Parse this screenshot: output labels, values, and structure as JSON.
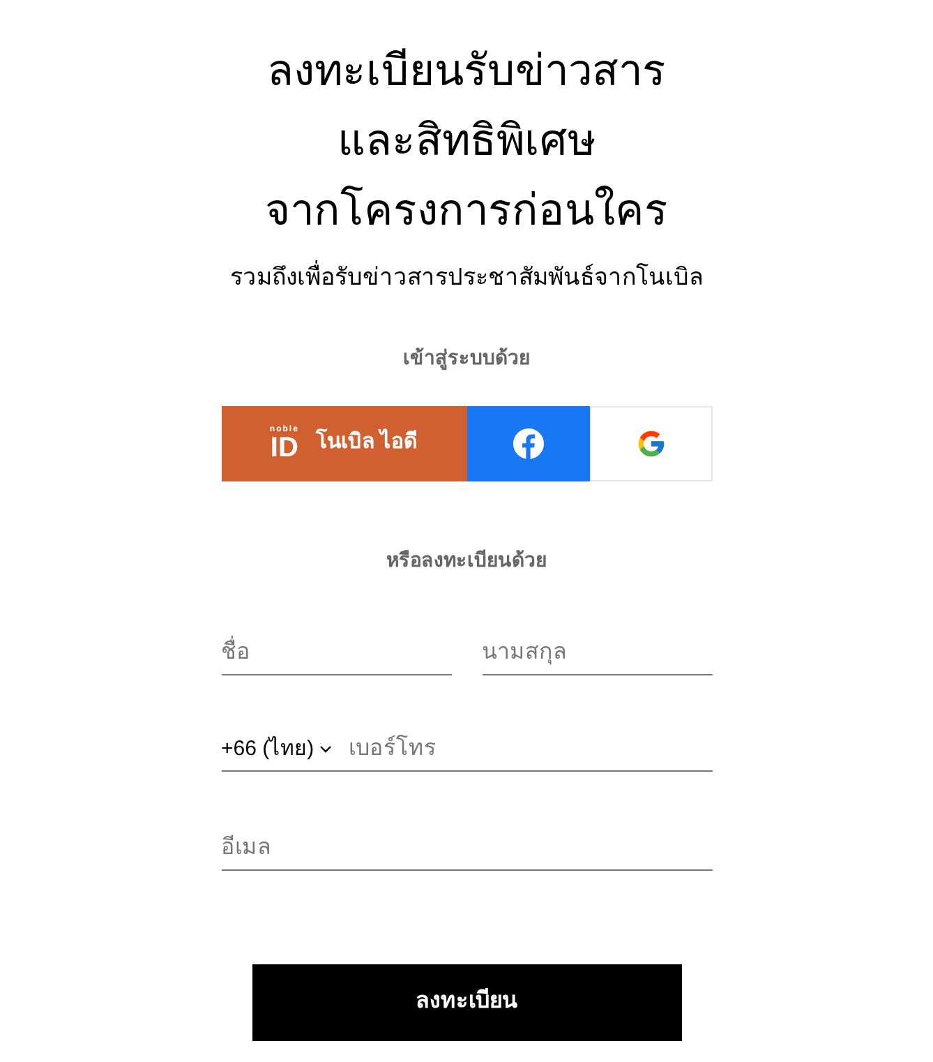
{
  "heading": {
    "lines": [
      "ลงทะเบียนรับข่าวสาร",
      "และสิทธิพิเศษ",
      "จากโครงการก่อนใคร"
    ]
  },
  "subtitle": "รวมถึงเพื่อรับข่าวสารประชาสัมพันธ์จากโนเบิล",
  "login_label": "เข้าสู่ระบบด้วย",
  "login_buttons": [
    {
      "kind": "noble",
      "logo_small": "noble",
      "logo_main": "ID",
      "label": "โนเบิล ไอดี"
    },
    {
      "kind": "facebook"
    },
    {
      "kind": "google"
    }
  ],
  "register_label": "หรือลงทะเบียนด้วย",
  "fields": {
    "first_name": {
      "placeholder": "ชื่อ"
    },
    "last_name": {
      "placeholder": "นามสกุล"
    },
    "country_code": "+66 (ไทย)",
    "phone": {
      "placeholder": "เบอร์โทร"
    },
    "email": {
      "placeholder": "อีเมล"
    }
  },
  "submit": "ลงทะเบียน"
}
